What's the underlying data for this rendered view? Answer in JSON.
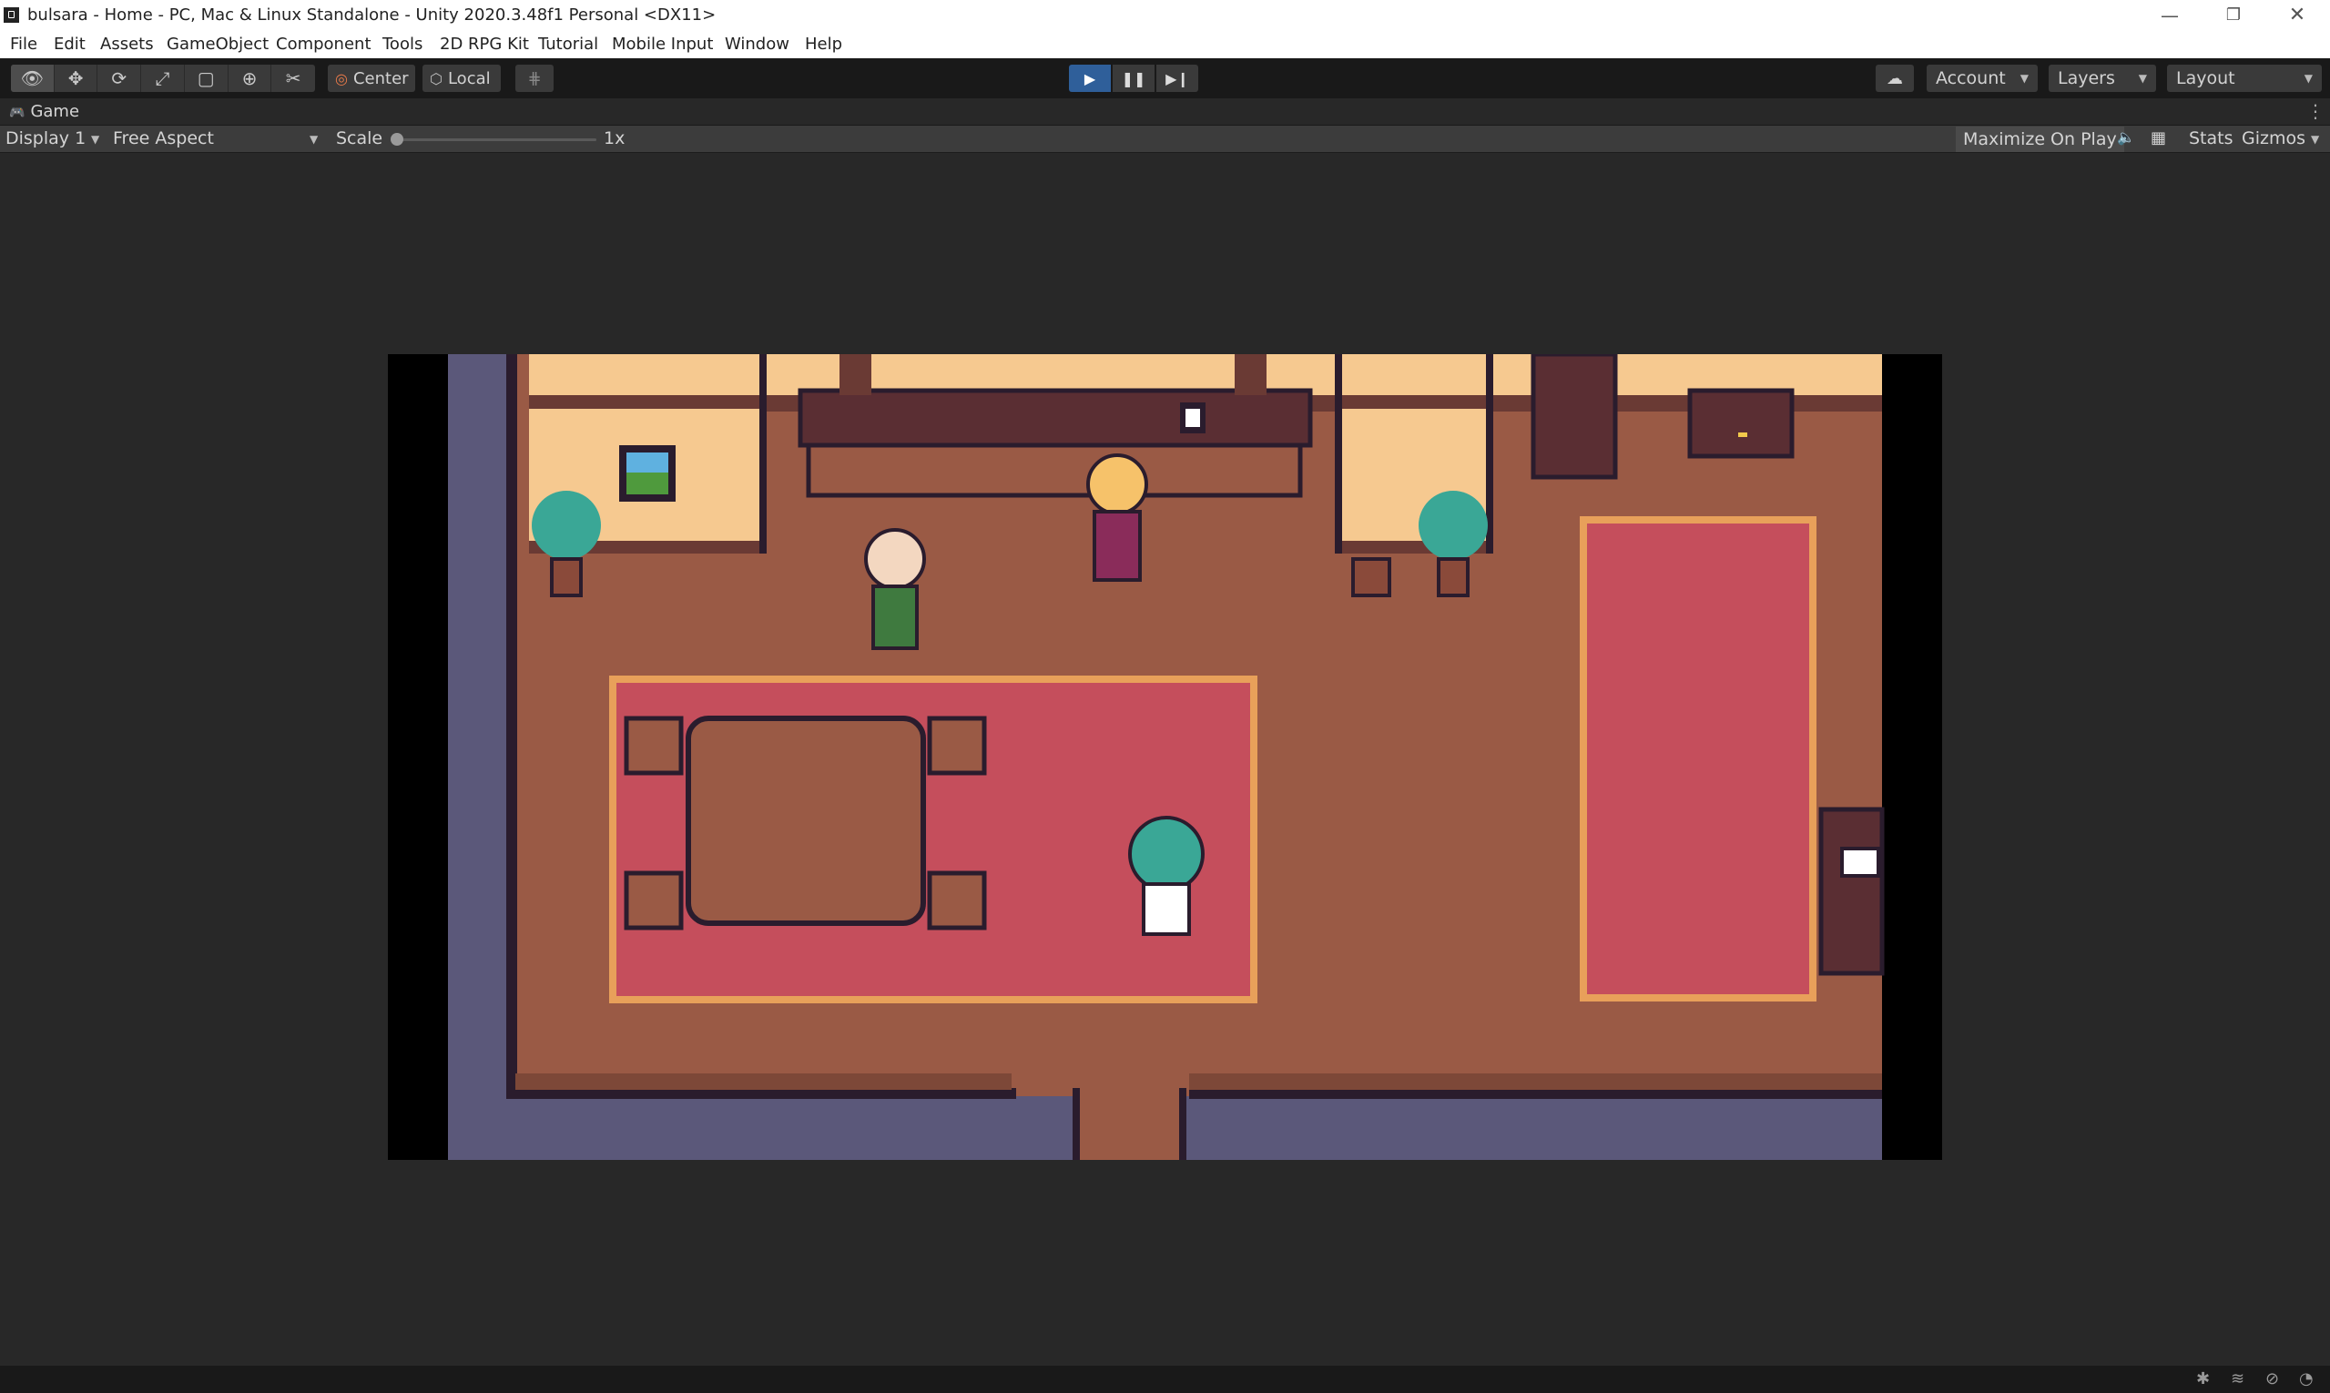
{
  "window": {
    "title": "bulsara - Home - PC, Mac & Linux Standalone - Unity 2020.3.48f1 Personal <DX11>",
    "minimize": "—",
    "maximize": "❐",
    "close": "✕"
  },
  "menu": [
    "File",
    "Edit",
    "Assets",
    "GameObject",
    "Component",
    "Tools",
    "2D RPG Kit",
    "Tutorial",
    "Mobile Input",
    "Window",
    "Help"
  ],
  "toolbar": {
    "pivot_label": "Center",
    "space_label": "Local",
    "account_label": "Account",
    "layers_label": "Layers",
    "layout_label": "Layout"
  },
  "game_tab": {
    "label": "Game"
  },
  "game_toolbar": {
    "display": "Display 1",
    "aspect": "Free Aspect",
    "scale_label": "Scale",
    "scale_value": "1x",
    "maximize": "Maximize On Play",
    "stats": "Stats",
    "gizmos": "Gizmos"
  },
  "colors": {
    "play_active": "#2f5f9a",
    "floor": "#9a5a45",
    "wall": "#f6c990",
    "rug": "#c54e5c",
    "outer_wall": "#5b587a",
    "wood_dark": "#5a2e33"
  }
}
